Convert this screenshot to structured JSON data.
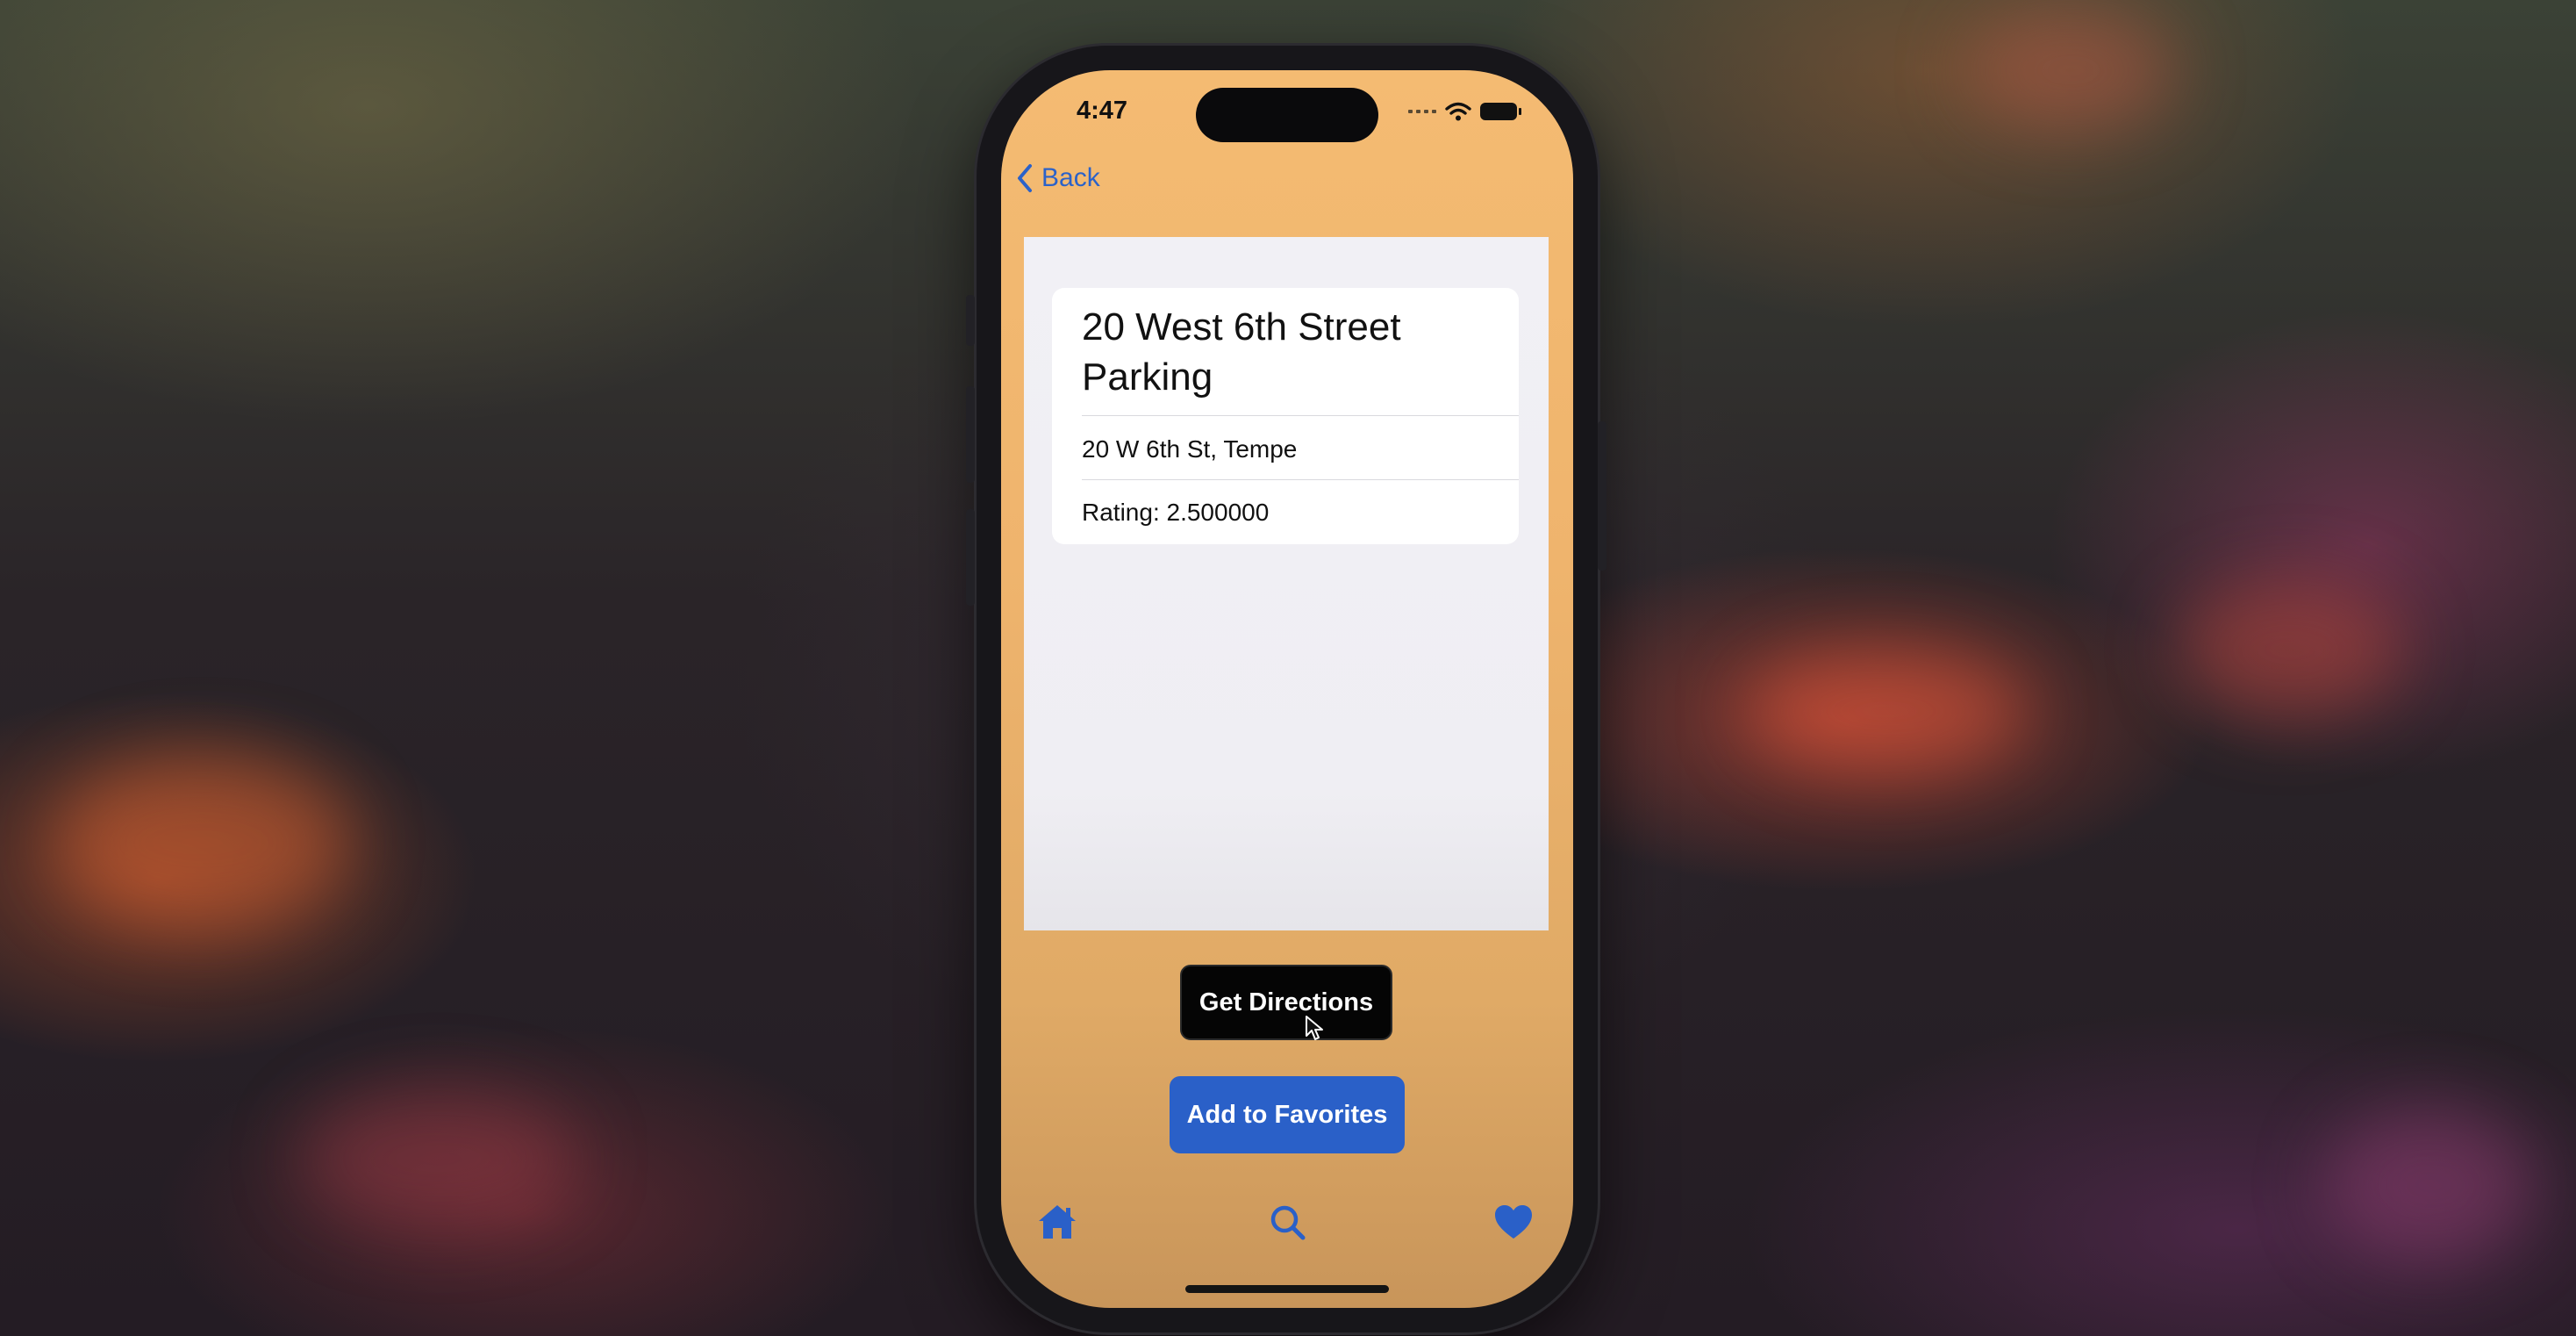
{
  "status_bar": {
    "time": "4:47"
  },
  "nav": {
    "back_label": "Back"
  },
  "detail": {
    "title": "20 West 6th Street Parking",
    "address": "20 W 6th St, Tempe",
    "rating": "Rating: 2.500000"
  },
  "actions": {
    "directions_label": "Get Directions",
    "favorites_label": "Add to Favorites"
  },
  "tab_bar": {
    "items": [
      "home-icon",
      "search-icon",
      "heart-icon"
    ]
  },
  "colors": {
    "accent": "#2a60c8",
    "background_orange": "#f4bb72",
    "primary_button": "#050505"
  }
}
